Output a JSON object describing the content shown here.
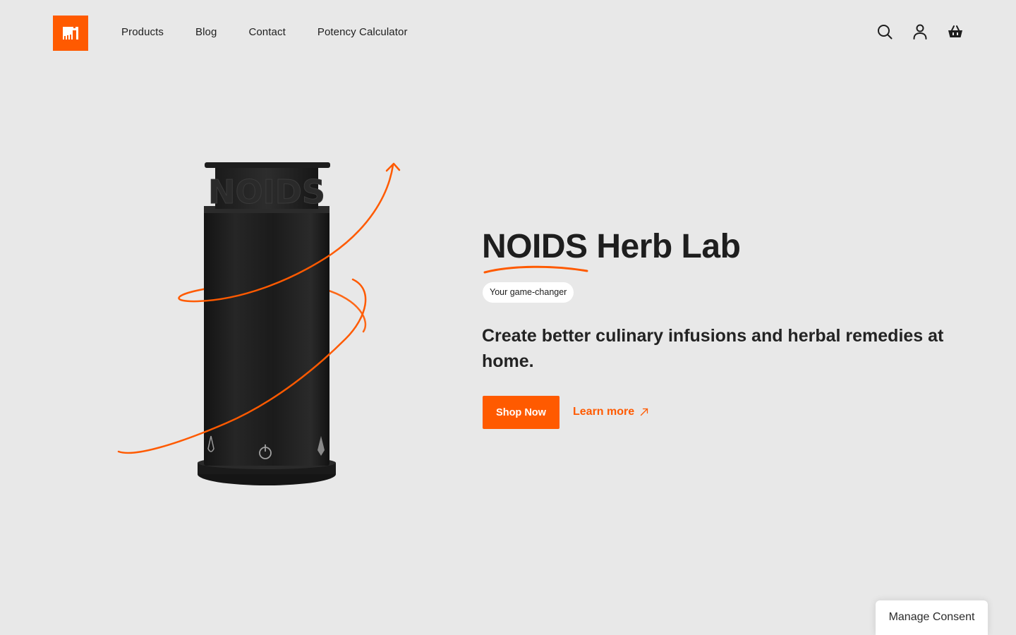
{
  "brand": {
    "logo_icon": "lab-logo-icon",
    "accent_color": "#ff5a00"
  },
  "nav": {
    "items": [
      {
        "label": "Products"
      },
      {
        "label": "Blog"
      },
      {
        "label": "Contact"
      },
      {
        "label": "Potency Calculator"
      }
    ]
  },
  "header_icons": [
    "search-icon",
    "user-icon",
    "basket-icon"
  ],
  "hero": {
    "title": "NOIDS Herb Lab",
    "badge": "Your game-changer",
    "subtitle": "Create better culinary infusions and herbal remedies at home.",
    "primary_cta": "Shop Now",
    "secondary_cta": "Learn more",
    "product_text": "NOIDS"
  },
  "consent": {
    "label": "Manage Consent"
  },
  "colors": {
    "background": "#e8e8e8",
    "accent": "#ff5a00",
    "text": "#1e1e1e",
    "device": "#1c1c1c"
  }
}
